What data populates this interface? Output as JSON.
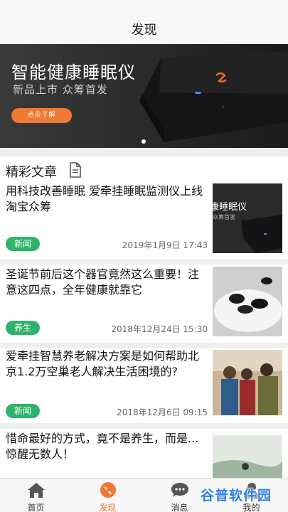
{
  "header": {
    "title": "发现"
  },
  "banner": {
    "headline": "智能健康睡眠仪",
    "subline": "新品上市 众筹首发",
    "cta_label": "点击了解"
  },
  "section": {
    "title": "精彩文章"
  },
  "articles": [
    {
      "title": "用科技改善睡眠 爱牵挂睡眠监测仪上线淘宝众筹",
      "tag": "新闻",
      "date": "2019年1月9日 17:43",
      "thumb_text": "康睡眠仪",
      "thumb_subtext": "众筹首发"
    },
    {
      "title": "圣诞节前后这个器官竟然这么重要！注意这四点，全年健康就靠它",
      "tag": "养生",
      "date": "2018年12月24日 15:30"
    },
    {
      "title": "爱牵挂智慧养老解决方案是如何帮助北京1.2万空巢老人解决生活困境的?",
      "tag": "新闻",
      "date": "2018年12月6日 09:15"
    },
    {
      "title": "惜命最好的方式，竟不是养生，而是...惊醒无数人！"
    }
  ],
  "tabbar": {
    "items": [
      {
        "label": "首页",
        "icon": "home-icon"
      },
      {
        "label": "发现",
        "icon": "compass-icon",
        "active": true
      },
      {
        "label": "消息",
        "icon": "chat-icon"
      },
      {
        "label": "我的",
        "icon": "person-icon"
      }
    ]
  },
  "watermark": {
    "text": "谷普软件园"
  },
  "colors": {
    "accent": "#f07a34",
    "tag_green": "#2fb36b",
    "background": "#efefef"
  }
}
